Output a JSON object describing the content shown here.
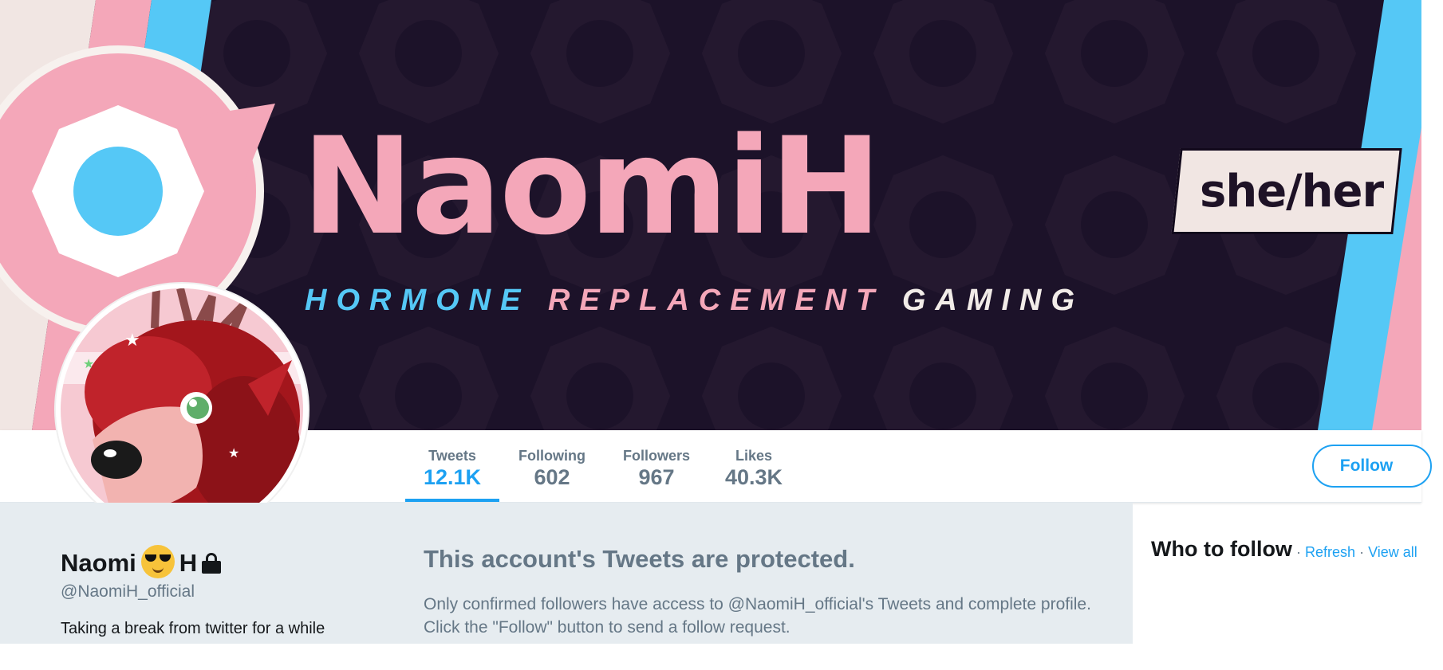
{
  "banner": {
    "title": "NaomiH",
    "subtitle_1": "HORMONE",
    "subtitle_2": "REPLACEMENT",
    "subtitle_3": "GAMING",
    "pronouns": "she/her"
  },
  "nav": {
    "stats": [
      {
        "label": "Tweets",
        "value": "12.1K",
        "active": true
      },
      {
        "label": "Following",
        "value": "602"
      },
      {
        "label": "Followers",
        "value": "967"
      },
      {
        "label": "Likes",
        "value": "40.3K"
      }
    ],
    "follow_label": "Follow"
  },
  "profile": {
    "name_first": "Naomi",
    "name_last": "H",
    "handle": "@NaomiH_official",
    "bio": "Taking a break from twitter for a while",
    "emoji": "smiling-face-with-sunglasses-icon",
    "protected_icon": "lock-icon"
  },
  "protected": {
    "title": "This account's Tweets are protected.",
    "line1": "Only confirmed followers have access to @NaomiH_official's Tweets and complete profile.",
    "line2": "Click the \"Follow\" button to send a follow request."
  },
  "who_to_follow": {
    "title": "Who to follow",
    "separator": "·",
    "refresh": "Refresh",
    "view_all": "View all"
  },
  "colors": {
    "accent": "#1da1f2",
    "banner_bg": "#1c1229",
    "trans_pink": "#f4a7b9",
    "trans_blue": "#55c8f6",
    "secondary_text": "#657786"
  }
}
